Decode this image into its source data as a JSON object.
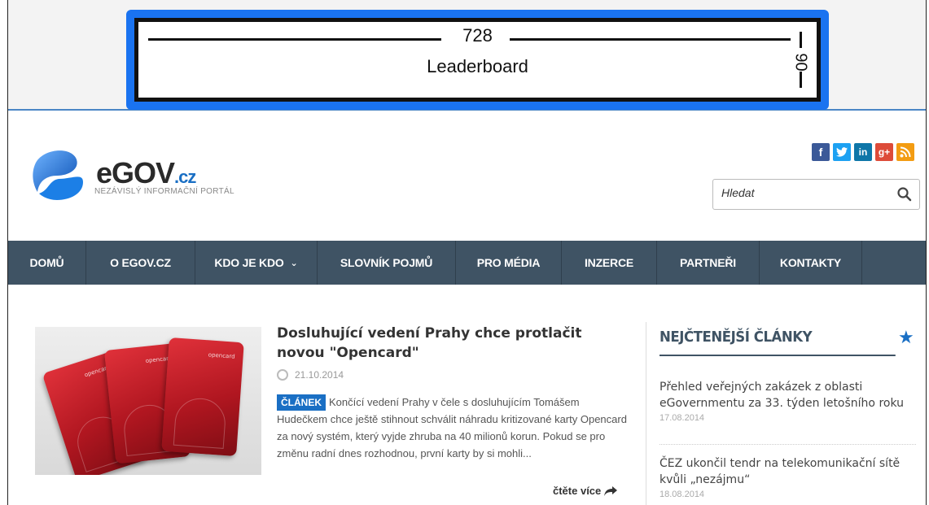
{
  "ad": {
    "width_label": "728",
    "height_label": "90",
    "name": "Leaderboard"
  },
  "header": {
    "logo_text": "eGOV",
    "logo_suffix": ".cz",
    "logo_tagline": "NEZÁVISLÝ INFORMAČNÍ PORTÁL",
    "social": [
      {
        "name": "facebook-icon",
        "glyph": "f"
      },
      {
        "name": "twitter-icon",
        "glyph": "t"
      },
      {
        "name": "linkedin-icon",
        "glyph": "in"
      },
      {
        "name": "googleplus-icon",
        "glyph": "g+"
      },
      {
        "name": "rss-icon",
        "glyph": "rss"
      }
    ],
    "search_placeholder": "Hledat"
  },
  "nav": {
    "items": [
      {
        "label": "DOMŮ"
      },
      {
        "label": "O EGOV.CZ"
      },
      {
        "label": "KDO JE KDO",
        "has_dropdown": true
      },
      {
        "label": "SLOVNÍK POJMŮ"
      },
      {
        "label": "PRO MÉDIA"
      },
      {
        "label": "INZERCE"
      },
      {
        "label": "PARTNEŘI"
      },
      {
        "label": "KONTAKTY"
      }
    ]
  },
  "article": {
    "title": "Dosluhující vedení Prahy chce protlačit novou \"Opencard\"",
    "date": "21.10.2014",
    "badge": "ČLÁNEK",
    "excerpt": "Končící vedení Prahy v čele s dosluhujícím Tomášem Hudečkem chce ještě stihnout schválit náhradu kritizované karty Opencard za nový systém, který vyjde zhruba na 40 milionů korun. Pokud se pro změnu radní dnes rozhodnou, první karty by si mohli...",
    "read_more": "čtěte více",
    "image_brand": "opencard"
  },
  "sidebar": {
    "title": "NEJČTENĚJŠÍ ČLÁNKY",
    "items": [
      {
        "title": "Přehled veřejných zakázek z oblasti eGovernmentu za 33. týden letošního roku",
        "date": "17.08.2014"
      },
      {
        "title": "ČEZ ukončil tendr na telekomunikační sítě kvůli „nezájmu“",
        "date": "18.08.2014"
      }
    ]
  },
  "colors": {
    "nav_bg": "#3f5364",
    "accent": "#1a6fc4",
    "ad_border": "#1a73f0"
  }
}
